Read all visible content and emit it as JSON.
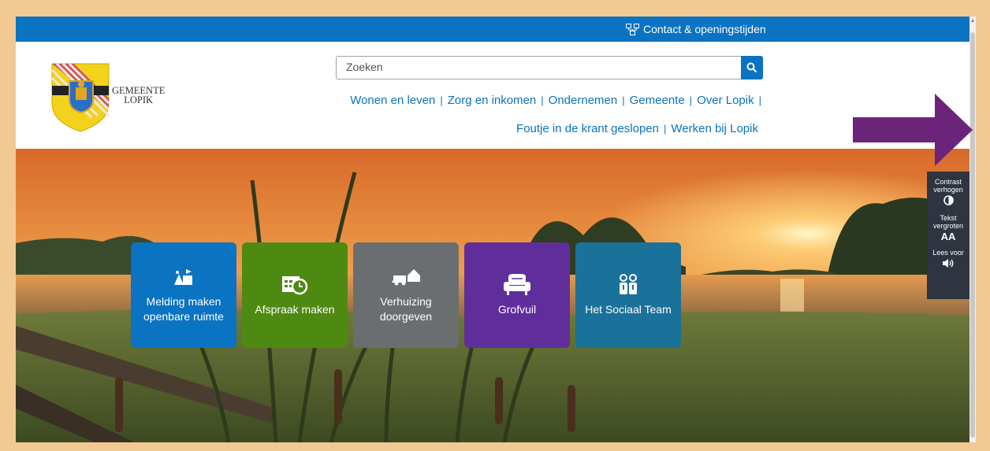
{
  "topbar": {
    "contact_label": "Contact & openingstijden"
  },
  "logo": {
    "line1": "GEMEENTE",
    "line2": "LOPIK"
  },
  "search": {
    "placeholder": "Zoeken"
  },
  "nav": {
    "row1": [
      "Wonen en leven",
      "Zorg en inkomen",
      "Ondernemen",
      "Gemeente",
      "Over Lopik"
    ],
    "row2": [
      "Foutje in de krant geslopen",
      "Werken bij Lopik"
    ]
  },
  "tiles": [
    {
      "label": "Melding maken openbare ruimte",
      "color": "#0a73c2",
      "icon": "report-icon"
    },
    {
      "label": "Afspraak maken",
      "color": "#4e8a12",
      "icon": "calendar-clock-icon"
    },
    {
      "label": "Verhuizing doorgeven",
      "color": "#6b6e70",
      "icon": "moving-truck-icon"
    },
    {
      "label": "Grofvuil",
      "color": "#5f2e9a",
      "icon": "armchair-icon"
    },
    {
      "label": "Het Sociaal Team",
      "color": "#1a7199",
      "icon": "people-icon"
    }
  ],
  "accessibility": {
    "contrast_label": "Contrast verhogen",
    "text_label": "Tekst vergroten",
    "text_symbol": "AA",
    "read_label": "Lees voor"
  },
  "colors": {
    "brand_blue": "#0a73c2",
    "frame_border": "#f3c993",
    "annotation_arrow": "#6b2479"
  }
}
